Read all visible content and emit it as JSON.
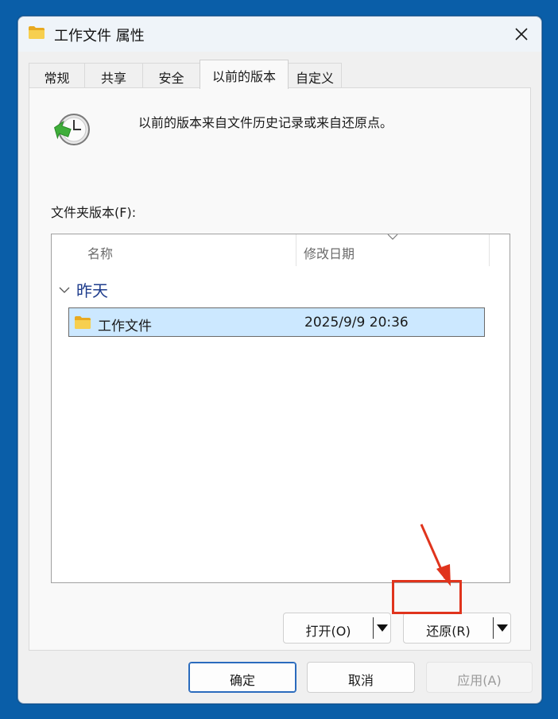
{
  "window": {
    "title": "工作文件 属性",
    "close_glyph": "✕"
  },
  "tabs": [
    {
      "label": "常规"
    },
    {
      "label": "共享"
    },
    {
      "label": "安全"
    },
    {
      "label": "以前的版本",
      "active": true
    },
    {
      "label": "自定义"
    }
  ],
  "panel": {
    "info_text": "以前的版本来自文件历史记录或来自还原点。",
    "section_label": "文件夹版本(F):",
    "list": {
      "columns": [
        "名称",
        "修改日期"
      ],
      "group": {
        "title": "昨天"
      },
      "rows": [
        {
          "name": "工作文件",
          "date": "2025/9/9 20:36",
          "selected": true
        }
      ]
    },
    "open_button": {
      "label": "打开(O)"
    },
    "restore_button": {
      "label": "还原(R)"
    }
  },
  "footer": {
    "ok_label": "确定",
    "cancel_label": "取消",
    "apply_label": "应用(A)"
  },
  "colors": {
    "desktop": "#0a5ea8",
    "selection": "#cce8ff",
    "group_title": "#1e3c8c",
    "highlight": "#e0341d",
    "folder": "#f5c342"
  },
  "icons": {
    "title": "folder-icon",
    "close": "close-icon",
    "info": "restore-clock-icon",
    "group_toggle": "chevron-down-icon",
    "row": "folder-icon",
    "dropdown": "caret-down-icon",
    "sort": "sort-chevron-icon"
  }
}
